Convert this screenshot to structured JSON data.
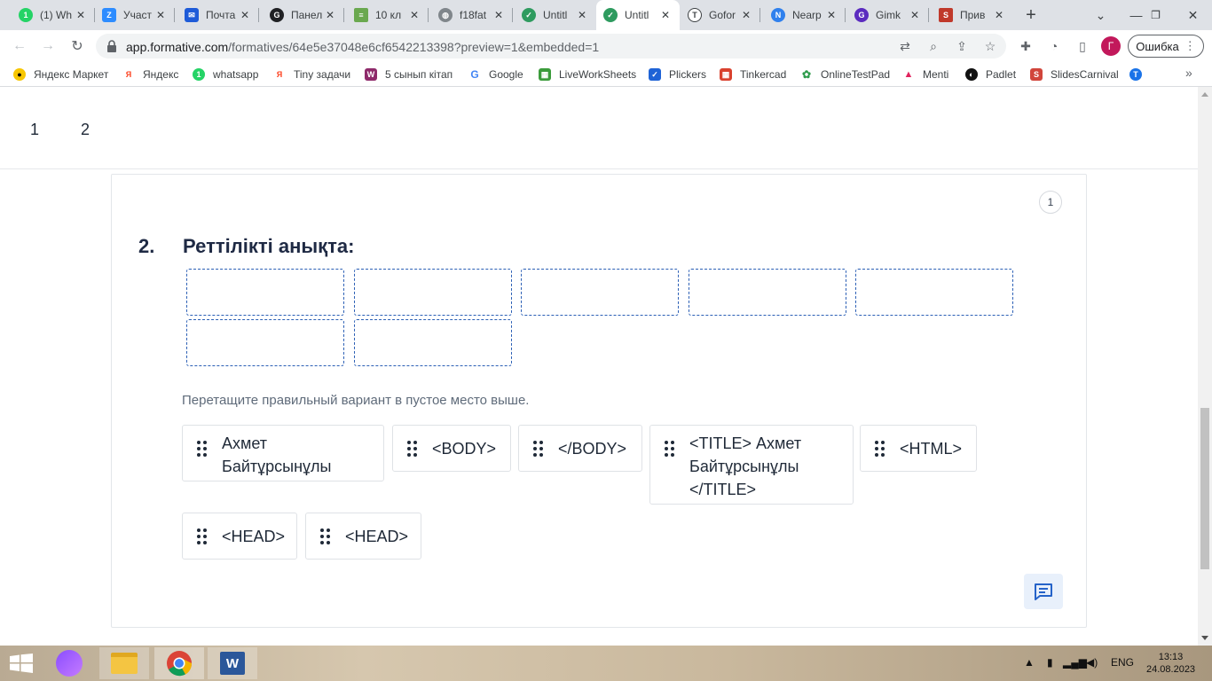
{
  "browser": {
    "tabs": [
      {
        "title": "(1) Wh",
        "icon": "whatsapp-icon",
        "color": "#25d366",
        "glyph": "1"
      },
      {
        "title": "Участ",
        "icon": "zoom-icon",
        "color": "#2d8cff",
        "glyph": "Z"
      },
      {
        "title": "Почта",
        "icon": "mail-icon",
        "color": "#1e5bd8",
        "glyph": "✉"
      },
      {
        "title": "Панел",
        "icon": "panel-icon",
        "color": "#202124",
        "glyph": "G"
      },
      {
        "title": "10 кл",
        "icon": "doc-icon",
        "color": "#6aa84f",
        "glyph": "≡"
      },
      {
        "title": "f18fat",
        "icon": "globe-icon",
        "color": "#80868b",
        "glyph": "◍"
      },
      {
        "title": "Untitl",
        "icon": "formative-icon",
        "color": "#2e9b5f",
        "glyph": "✓"
      },
      {
        "title": "Untitl",
        "icon": "formative-icon",
        "color": "#2e9b5f",
        "glyph": "✓",
        "active": true
      },
      {
        "title": "Gofor",
        "icon": "goformative-icon",
        "color": "#3c4043",
        "glyph": "T"
      },
      {
        "title": "Nearp",
        "icon": "nearpod-icon",
        "color": "#2f80ed",
        "glyph": "N"
      },
      {
        "title": "Gimk",
        "icon": "gimkit-icon",
        "color": "#5b2bbf",
        "glyph": "G"
      },
      {
        "title": "Прив",
        "icon": "slides-icon",
        "color": "#c0392b",
        "glyph": "S"
      }
    ],
    "new_tab_label": "+",
    "url_host": "app.formative.com",
    "url_path": "/formatives/64e5e37048e6cf6542213398?preview=1&embedded=1",
    "avatar_letter": "Г",
    "error_button": "Ошибка"
  },
  "bookmarks": [
    {
      "label": "Яндекс Маркет",
      "icon": "yandex-market-icon",
      "color": "#f7c600",
      "glyph": "●"
    },
    {
      "label": "Яндекс",
      "icon": "yandex-icon",
      "color": "#ffffff",
      "glyph": "Я",
      "fg": "#fc3f1d"
    },
    {
      "label": "whatsapp",
      "icon": "whatsapp-icon",
      "color": "#25d366",
      "glyph": "1"
    },
    {
      "label": "Tiny задачи",
      "icon": "yandex-icon",
      "color": "#ffffff",
      "glyph": "Я",
      "fg": "#fc3f1d"
    },
    {
      "label": "5 сынып кітап",
      "icon": "book-icon",
      "color": "#8e2a6a",
      "glyph": "W"
    },
    {
      "label": "Google",
      "icon": "google-icon",
      "color": "#ffffff",
      "glyph": "G",
      "fg": "#4285f4"
    },
    {
      "label": "LiveWorkSheets",
      "icon": "liveworksheets-icon",
      "color": "#3b9b3b",
      "glyph": "▦"
    },
    {
      "label": "Plickers",
      "icon": "plickers-icon",
      "color": "#1f63d6",
      "glyph": "✓"
    },
    {
      "label": "Tinkercad",
      "icon": "tinkercad-icon",
      "color": "#d9412e",
      "glyph": "▦"
    },
    {
      "label": "OnlineTestPad",
      "icon": "onlinetestpad-icon",
      "color": "#ffffff",
      "glyph": "✿",
      "fg": "#2d9b4b"
    },
    {
      "label": "Menti",
      "icon": "menti-icon",
      "color": "#ffffff",
      "glyph": "▲",
      "fg": "#e0245e"
    },
    {
      "label": "Padlet",
      "icon": "padlet-icon",
      "color": "#111111",
      "glyph": "◐"
    },
    {
      "label": "SlidesCarnival",
      "icon": "slidescarnival-icon",
      "color": "#d1453b",
      "glyph": "S"
    },
    {
      "label": "",
      "icon": "app-icon",
      "color": "#1a73e8",
      "glyph": "T"
    }
  ],
  "page": {
    "question_nav": [
      "1",
      "2"
    ],
    "points": "1",
    "question_number": "2.",
    "question_title": "Реттілікті анықта:",
    "hint": "Перетащите правильный вариант в пустое место выше.",
    "choices": [
      "Ахмет\nБайтұрсынұлы",
      "<BODY>",
      "</BODY>",
      "<TITLE> Ахмет\nБайтұрсынұлы\n</TITLE>",
      "<HTML>",
      "<HEAD>",
      "<HEAD>"
    ]
  },
  "taskbar": {
    "language": "ENG",
    "time": "13:13",
    "date": "24.08.2023"
  },
  "colors": {
    "slot_border": "#2b5fb5",
    "title": "#1f2a44",
    "chat_button_bg": "#e8f0fb"
  }
}
